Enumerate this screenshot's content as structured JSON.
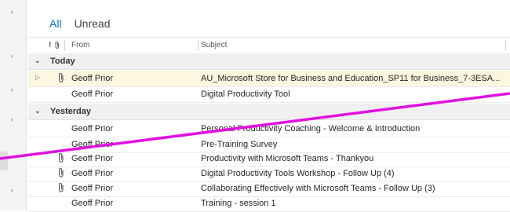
{
  "tabs": {
    "all": "All",
    "unread": "Unread"
  },
  "columns": {
    "importance": "!",
    "from": "From",
    "subject": "Subject"
  },
  "groups": {
    "today": "Today",
    "yesterday": "Yesterday"
  },
  "today": [
    {
      "from": "Geoff Prior",
      "subject": "AU_Microsoft Store for Business and Education_SP11 for Business_7-3ESA...",
      "attachment": true,
      "expand": true,
      "selected": true
    },
    {
      "from": "Geoff Prior",
      "subject": "Digital Productivity Tool",
      "attachment": false
    }
  ],
  "yesterday": [
    {
      "from": "Geoff Prior",
      "subject": "Personal Productivity Coaching - Welcome & Introduction",
      "attachment": false
    },
    {
      "from": "Geoff Prior",
      "subject": "Pre-Training Survey",
      "attachment": false
    },
    {
      "from": "Geoff Prior",
      "subject": "Productivity with Microsoft Teams - Thankyou",
      "attachment": true
    },
    {
      "from": "Geoff Prior",
      "subject": "Digital Productivity Tools Workshop - Follow Up (4)",
      "attachment": true
    },
    {
      "from": "Geoff Prior",
      "subject": "Collaborating Effectively with Microsoft Teams - Follow Up (3)",
      "attachment": true
    },
    {
      "from": "Geoff Prior",
      "subject": "Training - session 1",
      "attachment": false
    }
  ],
  "colors": {
    "accent": "#106ebe",
    "selected_row": "#fdf6e1",
    "annotation_line": "#e010e0"
  }
}
